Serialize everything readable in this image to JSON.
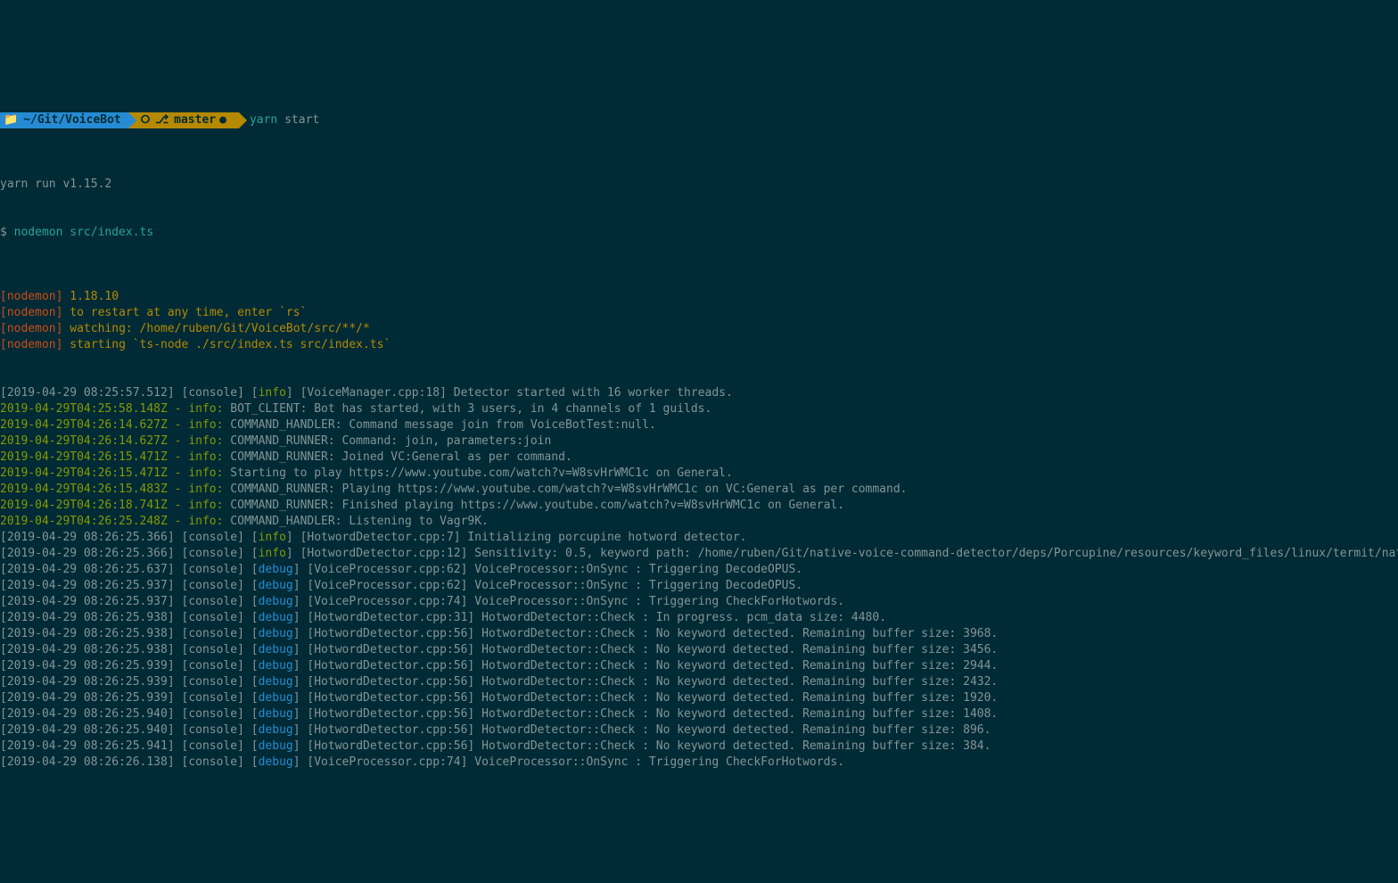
{
  "prompt": {
    "path_icon": "📁",
    "path": "~/Git/VoiceBot",
    "git_icon_a": "⎇",
    "branch_icon": "⎇",
    "branch": "master",
    "dirty_icon": "●",
    "cmd": "yarn",
    "arg": "start"
  },
  "header": {
    "yarn_run": "yarn run v1.15.2",
    "dollar": "$ ",
    "dollar_cmd": "nodemon src/index.ts"
  },
  "nodemon": [
    {
      "prefix": "[nodemon] ",
      "msg": "1.18.10"
    },
    {
      "prefix": "[nodemon] ",
      "msg": "to restart at any time, enter `rs`"
    },
    {
      "prefix": "[nodemon] ",
      "msg": "watching: /home/ruben/Git/VoiceBot/src/**/*"
    },
    {
      "prefix": "[nodemon] ",
      "msg": "starting `ts-node ./src/index.ts src/index.ts`"
    }
  ],
  "logs": [
    {
      "type": "console",
      "ts": "[2019-04-29 08:25:57.512] ",
      "src": "[console] ",
      "lvl": "info",
      "lvl_txt": "[info] ",
      "msg": "[VoiceManager.cpp:18] Detector started with 16 worker threads."
    },
    {
      "type": "winston",
      "ts": "2019-04-29T04:25:58.148Z - ",
      "lvl": "info",
      "lvl_txt": "info: ",
      "msg": "BOT_CLIENT: Bot has started, with 3 users, in 4 channels of 1 guilds."
    },
    {
      "type": "winston",
      "ts": "2019-04-29T04:26:14.627Z - ",
      "lvl": "info",
      "lvl_txt": "info: ",
      "msg": "COMMAND_HANDLER: Command message join from VoiceBotTest:null."
    },
    {
      "type": "winston",
      "ts": "2019-04-29T04:26:14.627Z - ",
      "lvl": "info",
      "lvl_txt": "info: ",
      "msg": "COMMAND_RUNNER: Command: join, parameters:join"
    },
    {
      "type": "winston",
      "ts": "2019-04-29T04:26:15.471Z - ",
      "lvl": "info",
      "lvl_txt": "info: ",
      "msg": "COMMAND_RUNNER: Joined VC:General as per command."
    },
    {
      "type": "winston",
      "ts": "2019-04-29T04:26:15.471Z - ",
      "lvl": "info",
      "lvl_txt": "info: ",
      "msg": "Starting to play https://www.youtube.com/watch?v=W8svHrWMC1c on General."
    },
    {
      "type": "winston",
      "ts": "2019-04-29T04:26:15.483Z - ",
      "lvl": "info",
      "lvl_txt": "info: ",
      "msg": "COMMAND_RUNNER: Playing https://www.youtube.com/watch?v=W8svHrWMC1c on VC:General as per command."
    },
    {
      "type": "winston",
      "ts": "2019-04-29T04:26:18.741Z - ",
      "lvl": "info",
      "lvl_txt": "info: ",
      "msg": "COMMAND_RUNNER: Finished playing https://www.youtube.com/watch?v=W8svHrWMC1c on General."
    },
    {
      "type": "winston",
      "ts": "2019-04-29T04:26:25.248Z - ",
      "lvl": "info",
      "lvl_txt": "info: ",
      "msg": "COMMAND_HANDLER: Listening to Vagr9K."
    },
    {
      "type": "console",
      "ts": "[2019-04-29 08:26:25.366] ",
      "src": "[console] ",
      "lvl": "info",
      "lvl_txt": "[info] ",
      "msg": "[HotwordDetector.cpp:7] Initializing porcupine hotword detector."
    },
    {
      "type": "console",
      "ts": "[2019-04-29 08:26:25.366] ",
      "src": "[console] ",
      "lvl": "info",
      "lvl_txt": "[info] ",
      "msg": "[HotwordDetector.cpp:12] Sensitivity: 0.5, keyword path: /home/ruben/Git/native-voice-command-detector/deps/Porcupine/resources/keyword_files/linux/termit/native-voice-command-detector/deps/Porcupine/lib/common/porcupine_params.pv."
    },
    {
      "type": "console",
      "ts": "[2019-04-29 08:26:25.637] ",
      "src": "[console] ",
      "lvl": "debug",
      "lvl_txt": "[debug] ",
      "msg": "[VoiceProcessor.cpp:62] VoiceProcessor::OnSync : Triggering DecodeOPUS."
    },
    {
      "type": "console",
      "ts": "[2019-04-29 08:26:25.937] ",
      "src": "[console] ",
      "lvl": "debug",
      "lvl_txt": "[debug] ",
      "msg": "[VoiceProcessor.cpp:62] VoiceProcessor::OnSync : Triggering DecodeOPUS."
    },
    {
      "type": "console",
      "ts": "[2019-04-29 08:26:25.937] ",
      "src": "[console] ",
      "lvl": "debug",
      "lvl_txt": "[debug] ",
      "msg": "[VoiceProcessor.cpp:74] VoiceProcessor::OnSync : Triggering CheckForHotwords."
    },
    {
      "type": "console",
      "ts": "[2019-04-29 08:26:25.938] ",
      "src": "[console] ",
      "lvl": "debug",
      "lvl_txt": "[debug] ",
      "msg": "[HotwordDetector.cpp:31] HotwordDetector::Check : In progress. pcm_data size: 4480."
    },
    {
      "type": "console",
      "ts": "[2019-04-29 08:26:25.938] ",
      "src": "[console] ",
      "lvl": "debug",
      "lvl_txt": "[debug] ",
      "msg": "[HotwordDetector.cpp:56] HotwordDetector::Check : No keyword detected. Remaining buffer size: 3968."
    },
    {
      "type": "console",
      "ts": "[2019-04-29 08:26:25.938] ",
      "src": "[console] ",
      "lvl": "debug",
      "lvl_txt": "[debug] ",
      "msg": "[HotwordDetector.cpp:56] HotwordDetector::Check : No keyword detected. Remaining buffer size: 3456."
    },
    {
      "type": "console",
      "ts": "[2019-04-29 08:26:25.939] ",
      "src": "[console] ",
      "lvl": "debug",
      "lvl_txt": "[debug] ",
      "msg": "[HotwordDetector.cpp:56] HotwordDetector::Check : No keyword detected. Remaining buffer size: 2944."
    },
    {
      "type": "console",
      "ts": "[2019-04-29 08:26:25.939] ",
      "src": "[console] ",
      "lvl": "debug",
      "lvl_txt": "[debug] ",
      "msg": "[HotwordDetector.cpp:56] HotwordDetector::Check : No keyword detected. Remaining buffer size: 2432."
    },
    {
      "type": "console",
      "ts": "[2019-04-29 08:26:25.939] ",
      "src": "[console] ",
      "lvl": "debug",
      "lvl_txt": "[debug] ",
      "msg": "[HotwordDetector.cpp:56] HotwordDetector::Check : No keyword detected. Remaining buffer size: 1920."
    },
    {
      "type": "console",
      "ts": "[2019-04-29 08:26:25.940] ",
      "src": "[console] ",
      "lvl": "debug",
      "lvl_txt": "[debug] ",
      "msg": "[HotwordDetector.cpp:56] HotwordDetector::Check : No keyword detected. Remaining buffer size: 1408."
    },
    {
      "type": "console",
      "ts": "[2019-04-29 08:26:25.940] ",
      "src": "[console] ",
      "lvl": "debug",
      "lvl_txt": "[debug] ",
      "msg": "[HotwordDetector.cpp:56] HotwordDetector::Check : No keyword detected. Remaining buffer size: 896."
    },
    {
      "type": "console",
      "ts": "[2019-04-29 08:26:25.941] ",
      "src": "[console] ",
      "lvl": "debug",
      "lvl_txt": "[debug] ",
      "msg": "[HotwordDetector.cpp:56] HotwordDetector::Check : No keyword detected. Remaining buffer size: 384."
    },
    {
      "type": "console",
      "ts": "[2019-04-29 08:26:26.138] ",
      "src": "[console] ",
      "lvl": "debug",
      "lvl_txt": "[debug] ",
      "msg": "[VoiceProcessor.cpp:74] VoiceProcessor::OnSync : Triggering CheckForHotwords."
    }
  ]
}
